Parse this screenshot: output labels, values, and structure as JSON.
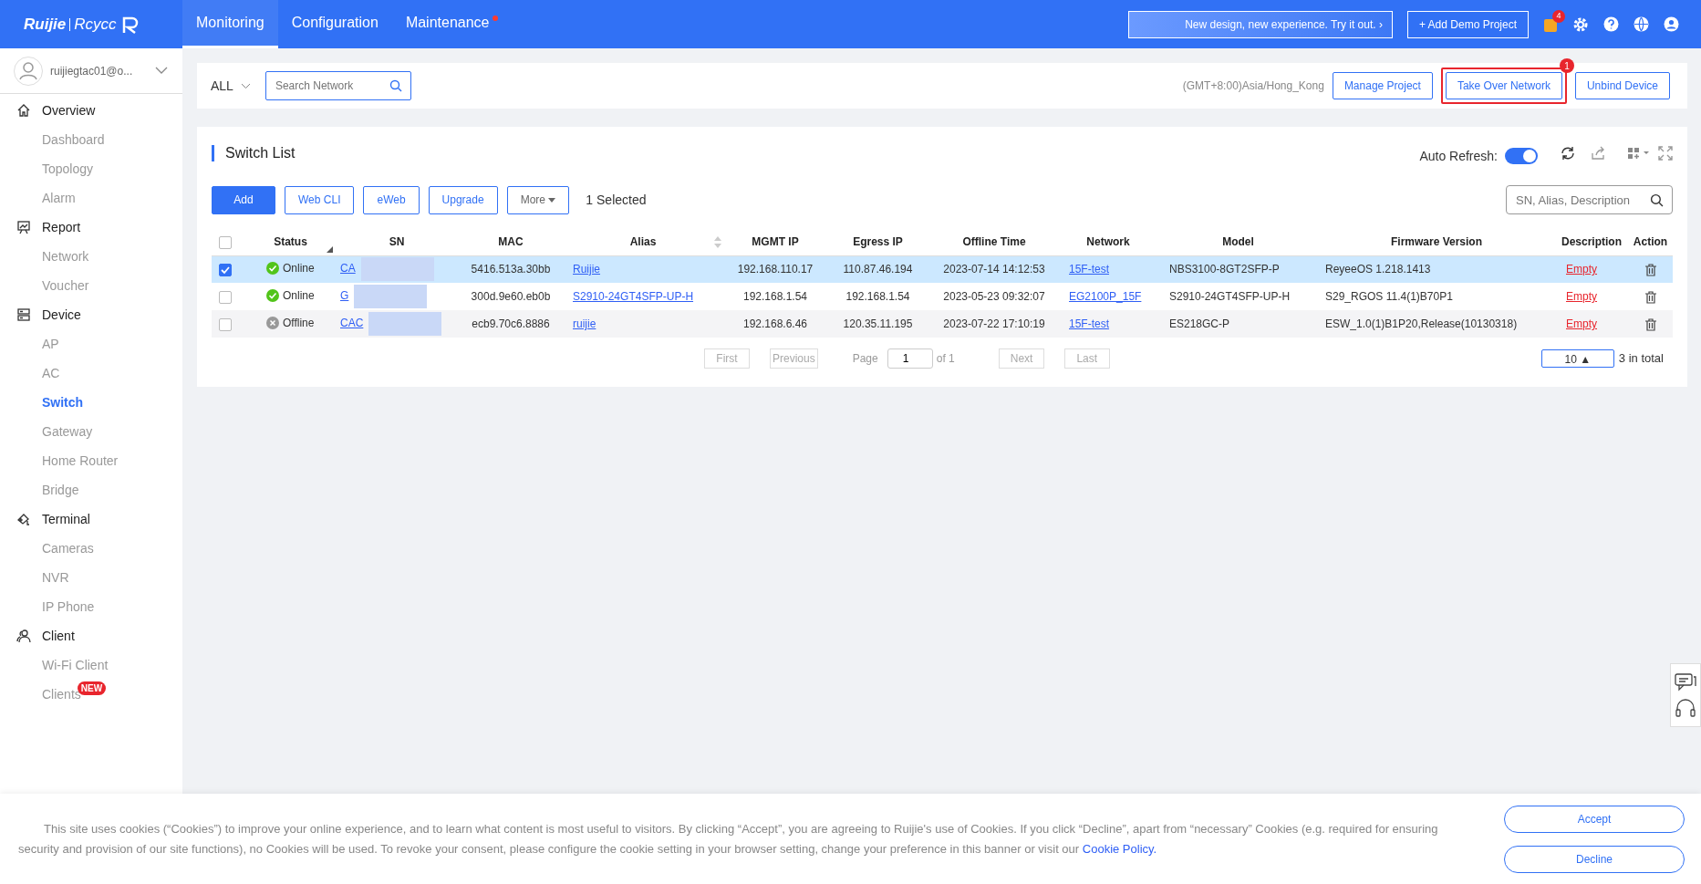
{
  "header": {
    "logo": [
      "Ruijie",
      "Rcycc"
    ],
    "nav": [
      {
        "label": "Monitoring",
        "selected": true,
        "dot": false
      },
      {
        "label": "Configuration",
        "selected": false,
        "dot": false
      },
      {
        "label": "Maintenance",
        "selected": false,
        "dot": true
      }
    ],
    "promo": "New design, new experience. Try it out.",
    "promo_arrow": "›",
    "add_demo": "+ Add Demo Project",
    "notification_count": "4"
  },
  "sidebar": {
    "user": "ruijiegtac01@o...",
    "groups": [
      {
        "label": "Overview",
        "kind": "home",
        "children": [
          {
            "label": "Dashboard",
            "selected": false
          },
          {
            "label": "Topology",
            "selected": false
          },
          {
            "label": "Alarm",
            "selected": false
          }
        ]
      },
      {
        "label": "Report",
        "kind": "report",
        "children": [
          {
            "label": "Network",
            "selected": false
          },
          {
            "label": "Voucher",
            "selected": false
          }
        ]
      },
      {
        "label": "Device",
        "kind": "device",
        "children": [
          {
            "label": "AP",
            "selected": false
          },
          {
            "label": "AC",
            "selected": false
          },
          {
            "label": "Switch",
            "selected": true
          },
          {
            "label": "Gateway",
            "selected": false
          },
          {
            "label": "Home Router",
            "selected": false
          },
          {
            "label": "Bridge",
            "selected": false
          }
        ]
      },
      {
        "label": "Terminal",
        "kind": "terminal",
        "children": [
          {
            "label": "Cameras",
            "selected": false
          },
          {
            "label": "NVR",
            "selected": false
          },
          {
            "label": "IP Phone",
            "selected": false
          }
        ]
      },
      {
        "label": "Client",
        "kind": "client",
        "children": [
          {
            "label": "Wi-Fi Client",
            "selected": false
          },
          {
            "label": "Clients",
            "selected": false,
            "badge": "NEW"
          }
        ]
      }
    ]
  },
  "toolbar": {
    "scope": "ALL",
    "search_placeholder": "Search Network",
    "timezone": "(GMT+8:00)Asia/Hong_Kong",
    "buttons": [
      {
        "label": "Manage Project",
        "highlighted": false
      },
      {
        "label": "Take Over Network",
        "highlighted": true,
        "badge": "1"
      },
      {
        "label": "Unbind Device",
        "highlighted": false
      }
    ]
  },
  "switch_list": {
    "title": "Switch List",
    "auto_refresh_label": "Auto Refresh:",
    "auto_refresh": true,
    "actions": [
      {
        "label": "Add",
        "primary": true,
        "dropdown": false
      },
      {
        "label": "Web CLI",
        "primary": false,
        "dropdown": false
      },
      {
        "label": "eWeb",
        "primary": false,
        "dropdown": false
      },
      {
        "label": "Upgrade",
        "primary": false,
        "dropdown": false
      },
      {
        "label": "More",
        "primary": false,
        "dropdown": true
      }
    ],
    "selected_count": "1 Selected",
    "search_placeholder": "SN, Alias, Description",
    "columns": [
      "Status",
      "SN",
      "MAC",
      "Alias",
      "MGMT IP",
      "Egress IP",
      "Offline Time",
      "Network",
      "Model",
      "Firmware Version",
      "Description",
      "Action"
    ],
    "all_checked": false,
    "rows": [
      {
        "selected": true,
        "status": "Online",
        "online": true,
        "sn": "CA",
        "mac": "5416.513a.30bb",
        "alias": "Ruijie",
        "mgmt_ip": "192.168.110.17",
        "egress_ip": "110.87.46.194",
        "offline_time": "2023-07-14 14:12:53",
        "network": "15F-test",
        "model": "NBS3100-8GT2SFP-P",
        "firmware": "ReyeeOS 1.218.1413",
        "description": "Empty"
      },
      {
        "selected": false,
        "status": "Online",
        "online": true,
        "sn": "G",
        "mac": "300d.9e60.eb0b",
        "alias": "S2910-24GT4SFP-UP-H",
        "mgmt_ip": "192.168.1.54",
        "egress_ip": "192.168.1.54",
        "offline_time": "2023-05-23 09:32:07",
        "network": "EG2100P_15F",
        "model": "S2910-24GT4SFP-UP-H",
        "firmware": "S29_RGOS 11.4(1)B70P1",
        "description": "Empty"
      },
      {
        "selected": false,
        "status": "Offline",
        "online": false,
        "sn": "CAC",
        "mac": "ecb9.70c6.8886",
        "alias": "ruijie",
        "mgmt_ip": "192.168.6.46",
        "egress_ip": "120.35.11.195",
        "offline_time": "2023-07-22 17:10:19",
        "network": "15F-test",
        "model": "ES218GC-P",
        "firmware": "ESW_1.0(1)B1P20,Release(10130318)",
        "description": "Empty"
      }
    ],
    "pagination": {
      "first": "First",
      "previous": "Previous",
      "page_label": "Page",
      "page": "1",
      "of": "of 1",
      "next": "Next",
      "last": "Last",
      "page_size": "10 ▲",
      "total": "3 in total"
    }
  },
  "cookie_banner": {
    "text": "This site uses cookies (“Cookies”) to improve your online experience, and to learn what content is most useful to visitors. By clicking “Accept”, you are agreeing to Ruijie's use of Cookies. If you click “Decline”, apart from “necessary” Cookies (e.g. required for ensuring security and provision of our site functions), no Cookies will be used. To revoke your consent, please configure the cookie setting in your browser setting, change your preference in this banner or visit our",
    "link": "Cookie Policy",
    "link_suffix": ".",
    "accept": "Accept",
    "decline": "Decline"
  }
}
